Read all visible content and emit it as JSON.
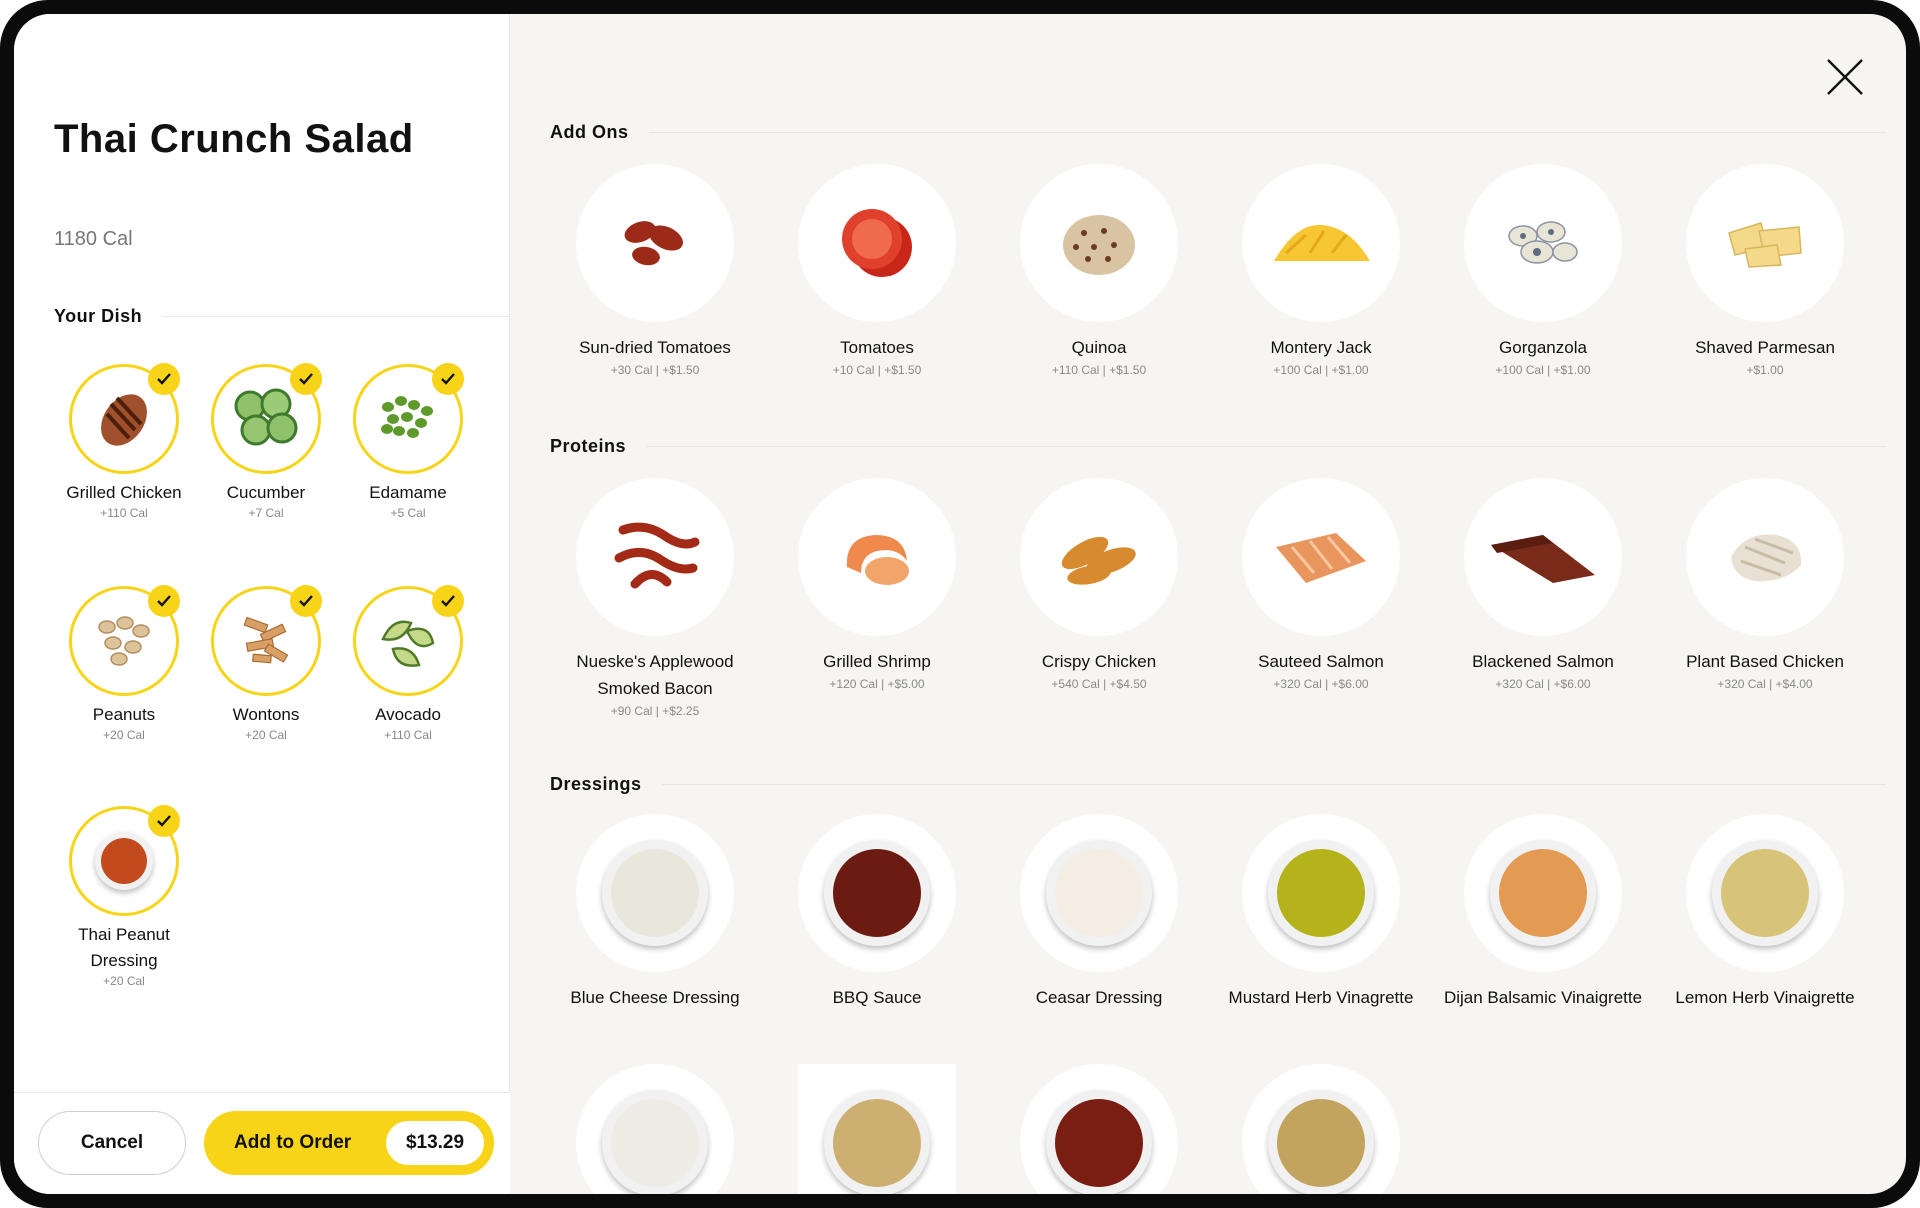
{
  "dish": {
    "title": "Thai Crunch Salad",
    "calories": "1180 Cal"
  },
  "your_dish": {
    "label": "Your Dish",
    "items": [
      {
        "name": "Grilled Chicken",
        "cal": "+110 Cal",
        "icon": "grilled-chicken"
      },
      {
        "name": "Cucumber",
        "cal": "+7 Cal",
        "icon": "cucumber"
      },
      {
        "name": "Edamame",
        "cal": "+5 Cal",
        "icon": "edamame"
      },
      {
        "name": "Peanuts",
        "cal": "+20 Cal",
        "icon": "peanuts"
      },
      {
        "name": "Wontons",
        "cal": "+20 Cal",
        "icon": "wontons"
      },
      {
        "name": "Avocado",
        "cal": "+110 Cal",
        "icon": "avocado"
      },
      {
        "name": "Thai Peanut Dressing",
        "cal": "+20 Cal",
        "icon": "dressing-bowl"
      }
    ]
  },
  "footer": {
    "cancel_label": "Cancel",
    "add_label": "Add to Order",
    "price": "$13.29"
  },
  "sections": {
    "addons": {
      "label": "Add Ons",
      "items": [
        {
          "name": "Sun-dried Tomatoes",
          "sub": "+30 Cal  |  +$1.50"
        },
        {
          "name": "Tomatoes",
          "sub": "+10 Cal  |  +$1.50"
        },
        {
          "name": "Quinoa",
          "sub": "+110 Cal  |  +$1.50"
        },
        {
          "name": "Montery Jack",
          "sub": "+100 Cal  |  +$1.00"
        },
        {
          "name": "Gorganzola",
          "sub": "+100 Cal  |  +$1.00"
        },
        {
          "name": "Shaved Parmesan",
          "sub": "+$1.00"
        }
      ]
    },
    "proteins": {
      "label": "Proteins",
      "items": [
        {
          "name": "Nueske's Applewood Smoked Bacon",
          "sub": "+90 Cal  |  +$2.25"
        },
        {
          "name": "Grilled Shrimp",
          "sub": "+120 Cal  |  +$5.00"
        },
        {
          "name": "Crispy Chicken",
          "sub": "+540 Cal  |  +$4.50"
        },
        {
          "name": "Sauteed Salmon",
          "sub": "+320 Cal  |  +$6.00"
        },
        {
          "name": "Blackened Salmon",
          "sub": "+320 Cal  |  +$6.00"
        },
        {
          "name": "Plant Based Chicken",
          "sub": "+320 Cal  |  +$4.00"
        }
      ]
    },
    "dressings": {
      "label": "Dressings",
      "items": [
        {
          "name": "Blue Cheese Dressing",
          "color": "#e9e6dc"
        },
        {
          "name": "BBQ Sauce",
          "color": "#6b1b12"
        },
        {
          "name": "Ceasar Dressing",
          "color": "#f3ede3"
        },
        {
          "name": "Mustard Herb Vinagrette",
          "color": "#b5b31c"
        },
        {
          "name": "Dijan Balsamic Vinaigrette",
          "color": "#e39a52"
        },
        {
          "name": "Lemon Herb Vinaigrette",
          "color": "#d8c479"
        }
      ],
      "more_colors": [
        "#eeece4",
        "#cdb071",
        "#7a1e14",
        "#c3a45f"
      ]
    }
  },
  "colors": {
    "accent": "#f8d418",
    "panel_bg": "#f6f5f2"
  }
}
